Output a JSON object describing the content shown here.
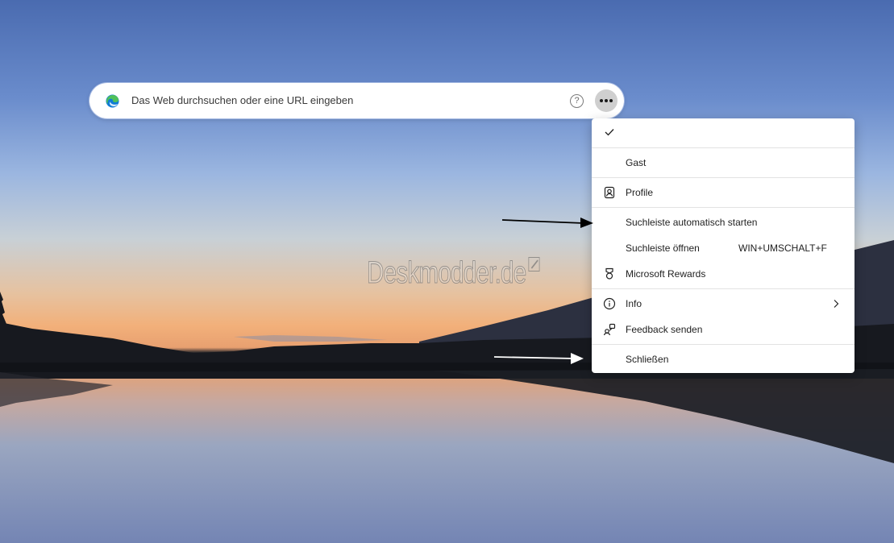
{
  "search": {
    "placeholder": "Das Web durchsuchen oder eine URL eingeben",
    "help_symbol": "?"
  },
  "watermark": {
    "text": "Deskmodder.de"
  },
  "menu": {
    "items": [
      {
        "label": "",
        "icon": "checkmark-icon"
      },
      {
        "label": "Gast"
      },
      {
        "label": "Profile",
        "icon": "profile-icon"
      },
      {
        "label": "Suchleiste automatisch starten"
      },
      {
        "label": "Suchleiste öffnen",
        "shortcut": "WIN+UMSCHALT+F"
      },
      {
        "label": "Microsoft Rewards",
        "icon": "rewards-icon"
      },
      {
        "label": "Info",
        "icon": "info-icon",
        "submenu_icon": "chevron-right-icon"
      },
      {
        "label": "Feedback senden",
        "icon": "feedback-icon"
      },
      {
        "label": "Schließen"
      }
    ]
  },
  "colors": {
    "menu_background": "#ffffff",
    "more_button": "#cfcfcf",
    "edge_blue": "#0f7bd6",
    "edge_green": "#4fc05a"
  }
}
